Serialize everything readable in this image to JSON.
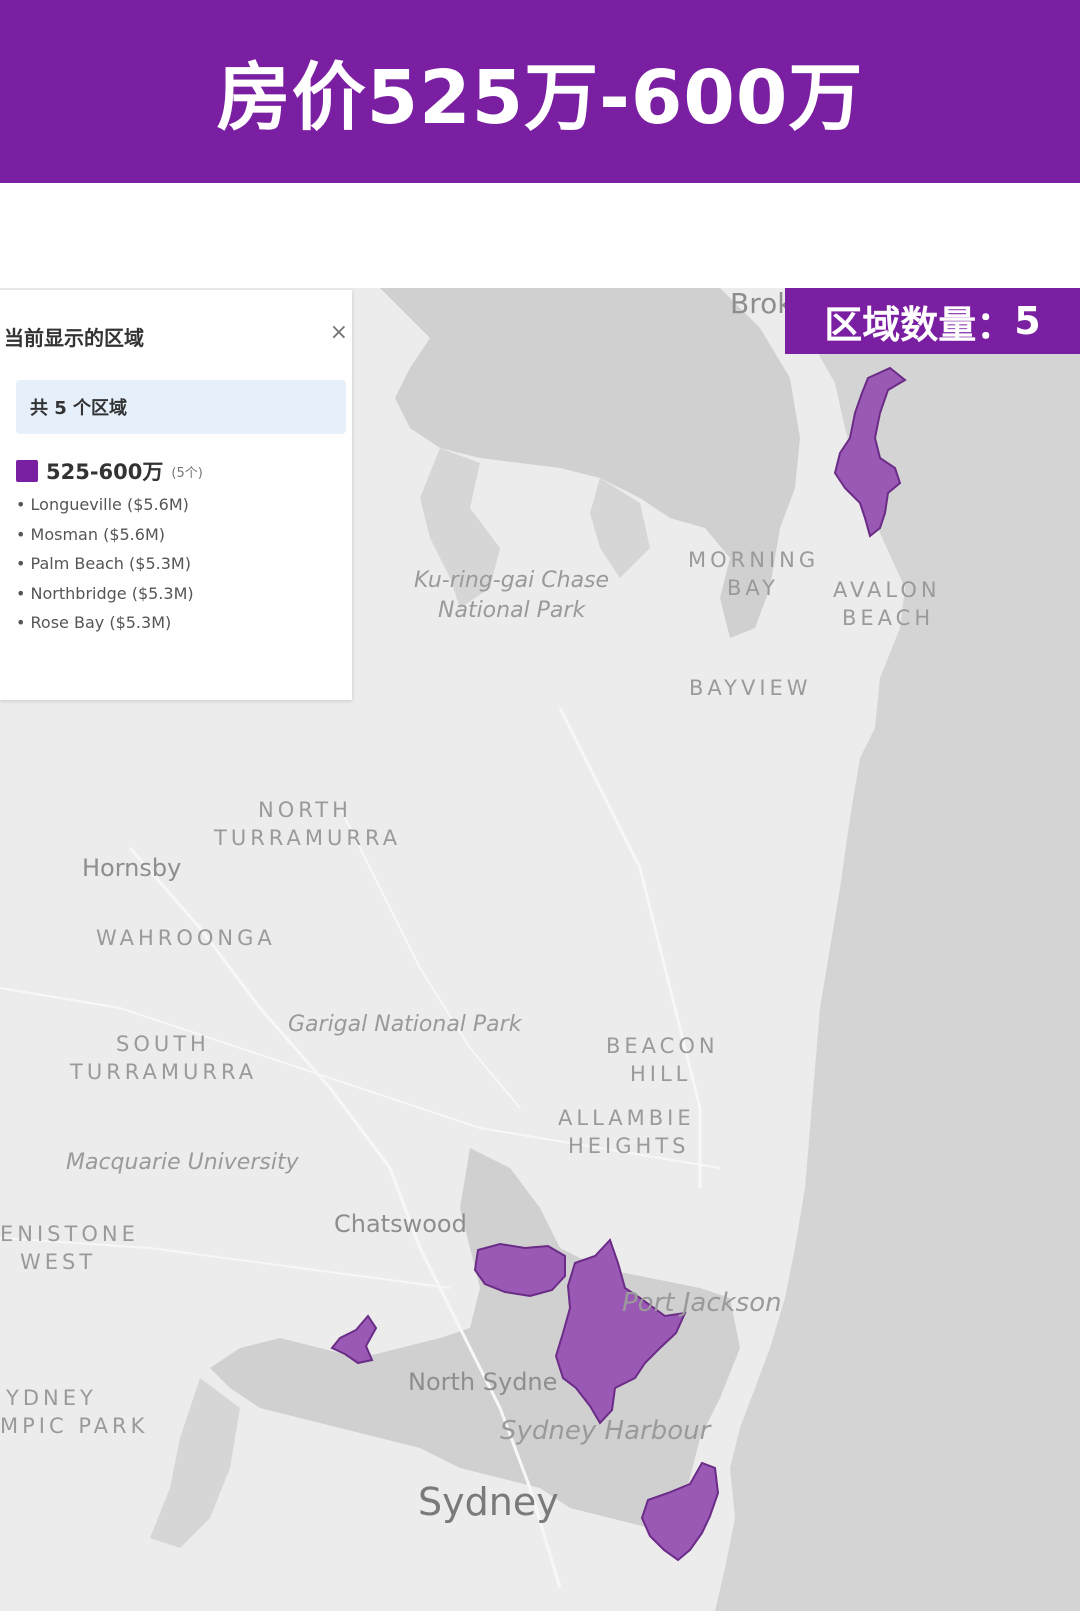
{
  "header": {
    "title": "房价525万-600万"
  },
  "badge": {
    "label": "区域数量：",
    "count": "5"
  },
  "legend": {
    "title": "当前显示的区域",
    "close_icon": "×",
    "summary": "共 5 个区域",
    "range_label": "525-600万",
    "range_count": "(5个)",
    "swatch_color": "#7b1fa2",
    "items": [
      "Longueville ($5.6M)",
      "Mosman ($5.6M)",
      "Palm Beach ($5.3M)",
      "Northbridge ($5.3M)",
      "Rose Bay ($5.3M)"
    ]
  },
  "map": {
    "highlight_color": "#9b59b6",
    "labels": {
      "brok": "Brok",
      "kuringgai_1": "Ku-ring-gai Chase",
      "kuringgai_2": "National Park",
      "morning_bay_1": "MORNING",
      "morning_bay_2": "BAY",
      "avalon_1": "AVALON",
      "avalon_2": "BEACH",
      "bayview": "BAYVIEW",
      "north_turramurra_1": "NORTH",
      "north_turramurra_2": "TURRAMURRA",
      "hornsby": "Hornsby",
      "wahroonga": "WAHROONGA",
      "garigal": "Garigal National Park",
      "south_turramurra_1": "SOUTH",
      "south_turramurra_2": "TURRAMURRA",
      "beacon_hill_1": "BEACON",
      "beacon_hill_2": "HILL",
      "allambie_1": "ALLAMBIE",
      "allambie_2": "HEIGHTS",
      "macquarie": "Macquarie University",
      "denistone_1": "ENISTONE",
      "denistone_2": "WEST",
      "chatswood": "Chatswood",
      "port_jackson": "Port Jackson",
      "north_sydney": "North Sydne",
      "sydney_olympic_1": "YDNEY",
      "sydney_olympic_2": "MPIC PARK",
      "sydney_harbour": "Sydney Harbour",
      "sydney": "Sydney"
    }
  }
}
